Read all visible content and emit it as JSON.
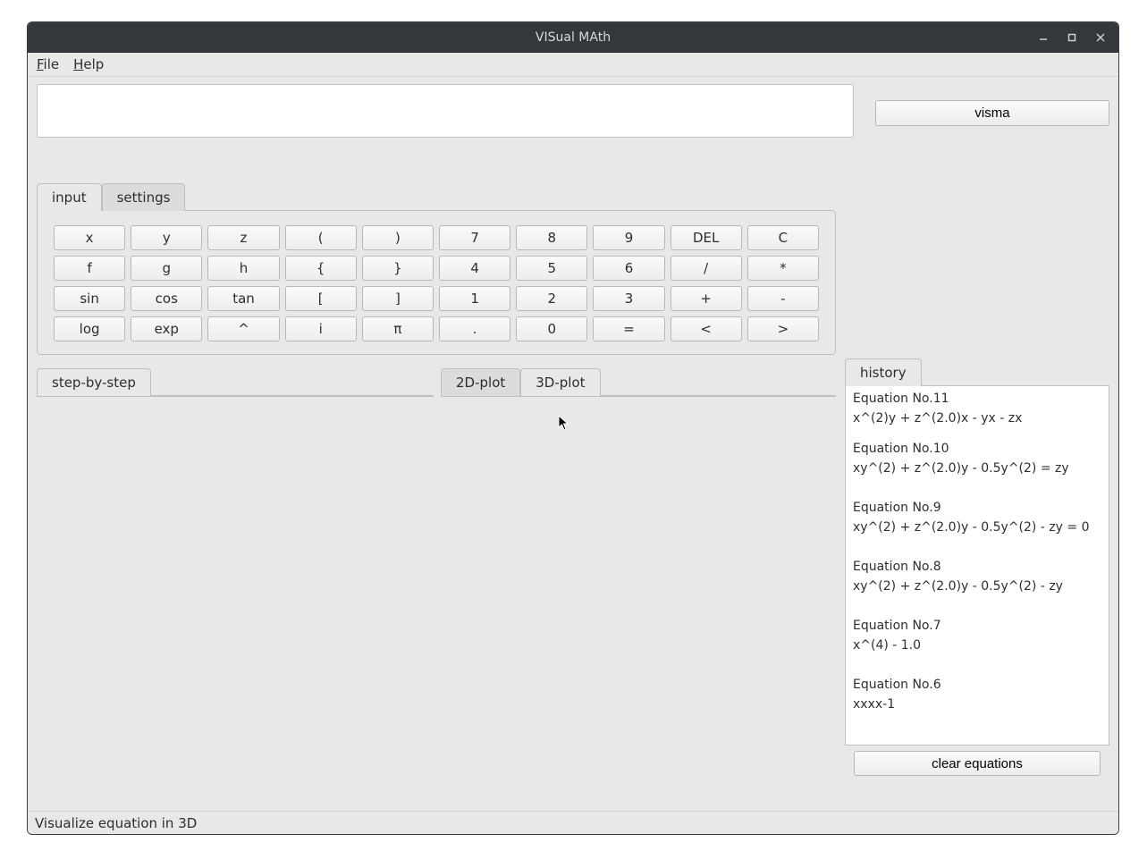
{
  "window": {
    "title": "VISual MAth"
  },
  "menu": {
    "file": "File",
    "help": "Help"
  },
  "visma_button": "visma",
  "tabs": {
    "input": "input",
    "settings": "settings"
  },
  "keypad": [
    [
      "x",
      "y",
      "z",
      "(",
      ")",
      "7",
      "8",
      "9",
      "DEL",
      "C"
    ],
    [
      "f",
      "g",
      "h",
      "{",
      "}",
      "4",
      "5",
      "6",
      "/",
      "*"
    ],
    [
      "sin",
      "cos",
      "tan",
      "[",
      "]",
      "1",
      "2",
      "3",
      "+",
      "-"
    ],
    [
      "log",
      "exp",
      "^",
      "i",
      "π",
      ".",
      "0",
      "=",
      "<",
      ">"
    ]
  ],
  "panels": {
    "step": "step-by-step",
    "plot2d": "2D-plot",
    "plot3d": "3D-plot",
    "history": "history"
  },
  "history": [
    {
      "title": "Equation No.11",
      "expr": "x^(2)y + z^(2.0)x - yx - zx"
    },
    {
      "title": "Equation No.10",
      "expr": "xy^(2) + z^(2.0)y - 0.5y^(2) = zy"
    },
    {
      "title": "Equation No.9",
      "expr": "xy^(2) + z^(2.0)y - 0.5y^(2) - zy = 0"
    },
    {
      "title": "Equation No.8",
      "expr": "xy^(2) + z^(2.0)y - 0.5y^(2) - zy"
    },
    {
      "title": "Equation No.7",
      "expr": "x^(4) - 1.0"
    },
    {
      "title": "Equation No.6",
      "expr": "xxxx-1"
    }
  ],
  "clear_button": "clear equations",
  "status": "Visualize equation in 3D"
}
